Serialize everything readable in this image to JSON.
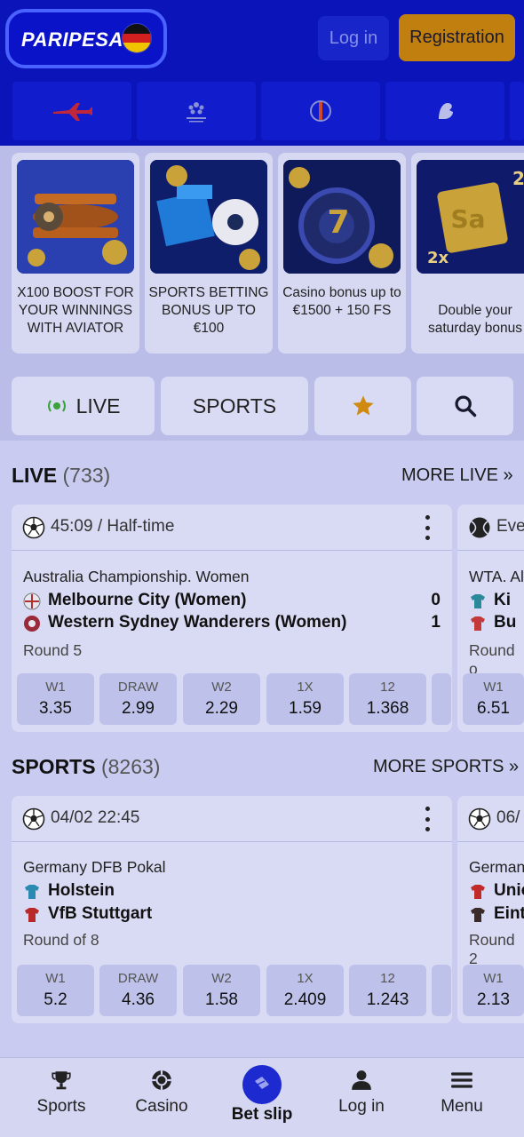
{
  "header": {
    "logo_text": "PARIPESA",
    "login_label": "Log in",
    "register_label": "Registration"
  },
  "tournaments": [
    "aviator-icon",
    "champions-league-icon",
    "europa-league-icon",
    "premier-league-icon"
  ],
  "promos": [
    {
      "text": "X100 BOOST FOR YOUR WINNINGS WITH AVIATOR",
      "icon": "aviator-plane-icon"
    },
    {
      "text": "SPORTS BETTING BONUS UP TO €100",
      "icon": "sports-bonus-icon"
    },
    {
      "text": "Casino bonus up to €1500 + 150 FS",
      "icon": "casino-roulette-icon"
    },
    {
      "text": "Double your saturday bonus",
      "icon": "saturday-calendar-icon"
    }
  ],
  "tabs": {
    "live": "LIVE",
    "sports": "SPORTS"
  },
  "live_section": {
    "title": "LIVE",
    "count": "(733)",
    "more": "MORE LIVE",
    "match": {
      "time": "45:09 / Half-time",
      "league": "Australia Championship. Women",
      "team1": "Melbourne City (Women)",
      "team2": "Western Sydney Wanderers (Women)",
      "score1": "0",
      "score2": "1",
      "round": "Round 5",
      "odds": [
        {
          "label": "W1",
          "value": "3.35"
        },
        {
          "label": "DRAW",
          "value": "2.99"
        },
        {
          "label": "W2",
          "value": "2.29"
        },
        {
          "label": "1X",
          "value": "1.59"
        },
        {
          "label": "12",
          "value": "1.368"
        }
      ]
    },
    "side_match": {
      "time": "Eve",
      "league": "WTA. Al",
      "team1": "Ki",
      "team2": "Bu",
      "round": "Round o",
      "odd_label": "W1",
      "odd_value": "6.51"
    }
  },
  "sports_section": {
    "title": "SPORTS",
    "count": "(8263)",
    "more": "MORE SPORTS",
    "match": {
      "time": "04/02 22:45",
      "league": "Germany DFB Pokal",
      "team1": "Holstein",
      "team2": "VfB Stuttgart",
      "round": "Round of 8",
      "odds": [
        {
          "label": "W1",
          "value": "5.2"
        },
        {
          "label": "DRAW",
          "value": "4.36"
        },
        {
          "label": "W2",
          "value": "1.58"
        },
        {
          "label": "1X",
          "value": "2.409"
        },
        {
          "label": "12",
          "value": "1.243"
        }
      ]
    },
    "side_match": {
      "time": "06/",
      "league": "German",
      "team1": "Unio",
      "team2": "Eint",
      "round": "Round 2",
      "odd_label": "W1",
      "odd_value": "2.13"
    }
  },
  "bottom_nav": {
    "sports": "Sports",
    "casino": "Casino",
    "betslip": "Bet slip",
    "login": "Log in",
    "menu": "Menu"
  },
  "colors": {
    "header_bg": "#0a14b8",
    "register_bg": "#c07f0e",
    "live_dot": "#3aa23a",
    "star": "#d08a10"
  }
}
